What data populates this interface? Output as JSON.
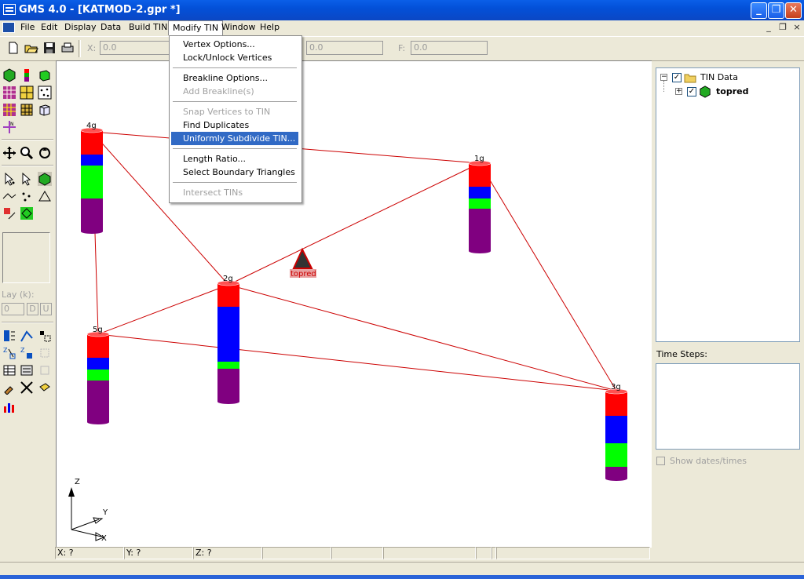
{
  "window": {
    "title": "GMS 4.0 - [KATMOD-2.gpr *]"
  },
  "titlebar_buttons": {
    "minimize": "_",
    "restore": "❐",
    "close": "✕"
  },
  "menubar": {
    "items": [
      "File",
      "Edit",
      "Display",
      "Data",
      "Build TIN",
      "Modify TIN",
      "Window",
      "Help"
    ],
    "mdi": {
      "minimize": "_",
      "restore": "❐",
      "close": "×"
    }
  },
  "toolbar": {
    "x_label": "X:",
    "x_value": "0.0",
    "z_value": "0.0",
    "f_label": "F:",
    "f_value": "0.0"
  },
  "modify_tin_menu": {
    "items": [
      {
        "label": "Vertex Options...",
        "disabled": false
      },
      {
        "label": "Lock/Unlock Vertices",
        "disabled": false
      },
      {
        "label": "Breakline Options...",
        "disabled": false
      },
      {
        "label": "Add Breakline(s)",
        "disabled": true
      },
      {
        "label": "Snap Vertices to TIN",
        "disabled": true
      },
      {
        "label": "Find Duplicates",
        "disabled": false
      },
      {
        "label": "Uniformly Subdivide TIN...",
        "disabled": false,
        "highlighted": true
      },
      {
        "label": "Length Ratio...",
        "disabled": false
      },
      {
        "label": "Select Boundary Triangles",
        "disabled": false
      },
      {
        "label": "Intersect TINs",
        "disabled": true
      }
    ]
  },
  "palette": {
    "lay_label": "Lay (k):",
    "lay_value": "0",
    "d_label": "D",
    "u_label": "U"
  },
  "boreholes": [
    {
      "label": "4g",
      "layers": [
        "red",
        "blue",
        "green",
        "purple"
      ]
    },
    {
      "label": "1g",
      "layers": [
        "red",
        "blue",
        "green",
        "purple"
      ]
    },
    {
      "label": "2g",
      "layers": [
        "red",
        "blue",
        "green",
        "purple"
      ]
    },
    {
      "label": "5g",
      "layers": [
        "red",
        "blue",
        "green",
        "purple"
      ]
    },
    {
      "label": "3g",
      "layers": [
        "red",
        "blue",
        "green",
        "purple"
      ]
    }
  ],
  "tin_label": "topred",
  "axes": {
    "z": "Z",
    "y": "Y",
    "x": "X"
  },
  "statusbar": {
    "x": "X: ?",
    "y": "Y: ?",
    "z": "Z: ?"
  },
  "tree": {
    "root": "TIN Data",
    "child": "topred",
    "root_expander": "−",
    "child_expander": "+"
  },
  "time_steps_label": "Time Steps:",
  "show_dates_label": "Show dates/times",
  "colors": {
    "red": "#ff0000",
    "blue": "#0000ff",
    "green": "#00ff00",
    "purple": "#800080",
    "tin_edge": "#cc0000",
    "menu_highlight": "#316ac5"
  }
}
